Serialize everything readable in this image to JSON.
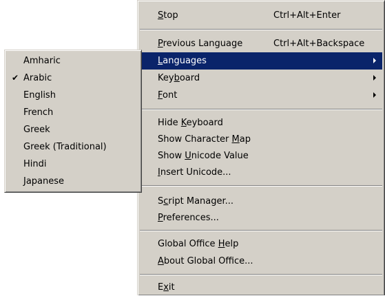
{
  "main_menu": {
    "items": [
      {
        "pre": "",
        "key": "S",
        "post": "top",
        "shortcut": "Ctrl+Alt+Enter",
        "submenu": false
      },
      {
        "pre": "",
        "key": "P",
        "post": "revious Language",
        "shortcut": "Ctrl+Alt+Backspace",
        "submenu": false
      },
      {
        "pre": "",
        "key": "L",
        "post": "anguages",
        "shortcut": "",
        "submenu": true,
        "highlighted": true
      },
      {
        "pre": "Key",
        "key": "b",
        "post": "oard",
        "shortcut": "",
        "submenu": true
      },
      {
        "pre": "",
        "key": "F",
        "post": "ont",
        "shortcut": "",
        "submenu": true
      },
      {
        "pre": "Hide ",
        "key": "K",
        "post": "eyboard",
        "shortcut": "",
        "submenu": false
      },
      {
        "pre": "Show Character ",
        "key": "M",
        "post": "ap",
        "shortcut": "",
        "submenu": false
      },
      {
        "pre": "Show ",
        "key": "U",
        "post": "nicode Value",
        "shortcut": "",
        "submenu": false
      },
      {
        "pre": "",
        "key": "I",
        "post": "nsert Unicode...",
        "shortcut": "",
        "submenu": false
      },
      {
        "pre": "S",
        "key": "c",
        "post": "ript Manager...",
        "shortcut": "",
        "submenu": false
      },
      {
        "pre": "",
        "key": "P",
        "post": "references...",
        "shortcut": "",
        "submenu": false
      },
      {
        "pre": "Global Office ",
        "key": "H",
        "post": "elp",
        "shortcut": "",
        "submenu": false
      },
      {
        "pre": "",
        "key": "A",
        "post": "bout Global Office...",
        "shortcut": "",
        "submenu": false
      },
      {
        "pre": "E",
        "key": "x",
        "post": "it",
        "shortcut": "",
        "submenu": false
      }
    ]
  },
  "languages_submenu": {
    "items": [
      {
        "label": "Amharic",
        "checked": false
      },
      {
        "label": "Arabic",
        "checked": true
      },
      {
        "label": "English",
        "checked": false
      },
      {
        "label": "French",
        "checked": false
      },
      {
        "label": "Greek",
        "checked": false
      },
      {
        "label": "Greek (Traditional)",
        "checked": false
      },
      {
        "label": "Hindi",
        "checked": false
      },
      {
        "label": "Japanese",
        "checked": false
      }
    ],
    "check_glyph": "✔"
  },
  "colors": {
    "menu_bg": "#d4d0c8",
    "highlight_bg": "#0a246a",
    "highlight_text": "#ffffff"
  }
}
